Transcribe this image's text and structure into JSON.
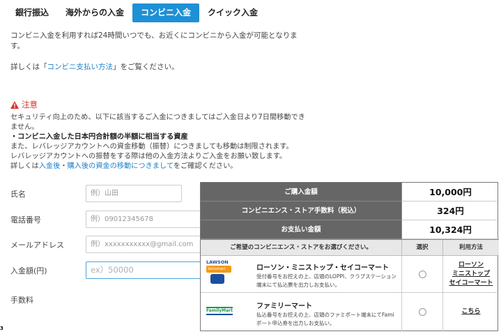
{
  "tabs": [
    {
      "label": "銀行振込",
      "active": false
    },
    {
      "label": "海外からの入金",
      "active": false
    },
    {
      "label": "コンビニ入金",
      "active": true
    },
    {
      "label": "クイック入金",
      "active": false
    }
  ],
  "intro": {
    "text": "コンビニ入金を利用すれば24時間いつでも、お近くにコンビニから入金が可能となります。",
    "detail_prefix": "詳しくは「",
    "detail_link": "コンビニ支払い方法",
    "detail_suffix": "」をご覧ください。"
  },
  "caution": {
    "title": "注意",
    "line1": "セキュリティ向上のため、以下に該当するご入金につきましてはご入金日より7日間移動できません。",
    "bold_line": "・コンビニ入金した日本円合計額の半額に相当する資産",
    "line2": "また、レバレッジアカウントへの資金移動（振替）につきましても移動は制限されます。",
    "line3": "レバレッジアカウントへの振替をする際は他の入金方法よりご入金をお願い致します。",
    "line4_prefix": "詳しくは",
    "link1": "入金後",
    "separator": "・",
    "link2": "購入後の資金の移動につきまして",
    "line4_suffix": "をご確認ください。"
  },
  "form": {
    "name_label": "氏名",
    "name_placeholder": "例）山田",
    "phone_label": "電話番号",
    "phone_placeholder": "例）09012345678",
    "email_label": "メールアドレス",
    "email_placeholder": "例）xxxxxxxxxxx@gmail.com",
    "amount_label": "入金額(円)",
    "amount_placeholder": "ex）50000",
    "fee_label": "手数料"
  },
  "corner_number": "3",
  "panel": {
    "purchase_label": "ご購入金額",
    "purchase_value": "10,000円",
    "fee_label": "コンビニエンス・ストア手数料（税込）",
    "fee_value": "324円",
    "total_label": "お支払い金額",
    "total_value": "10,324円",
    "header_store": "ご希望のコンビニエンス・ストアをお選びください。",
    "header_select": "選択",
    "header_method": "利用方法",
    "stores": [
      {
        "name": "ローソン・ミニストップ・セイコーマート",
        "desc": "受付番号をお控えの上、店頭のLOPPI、クラブステーション端末にて払込票を出力しお支払い。",
        "methods": [
          "ローソン",
          "ミニストップ",
          "セイコーマート"
        ],
        "logo_text": "LAWSON",
        "logo_sub": "Seicomart",
        "logo_color": "#1a4fa0"
      },
      {
        "name": "ファミリーマート",
        "desc": "払込番号をお控えの上、店頭のファミポート端末にてFamiポート申込券を出力しお支払い。",
        "methods": [
          "こちら"
        ],
        "logo_text": "FamilyMart",
        "logo_color": "#1c9a4a"
      }
    ]
  }
}
